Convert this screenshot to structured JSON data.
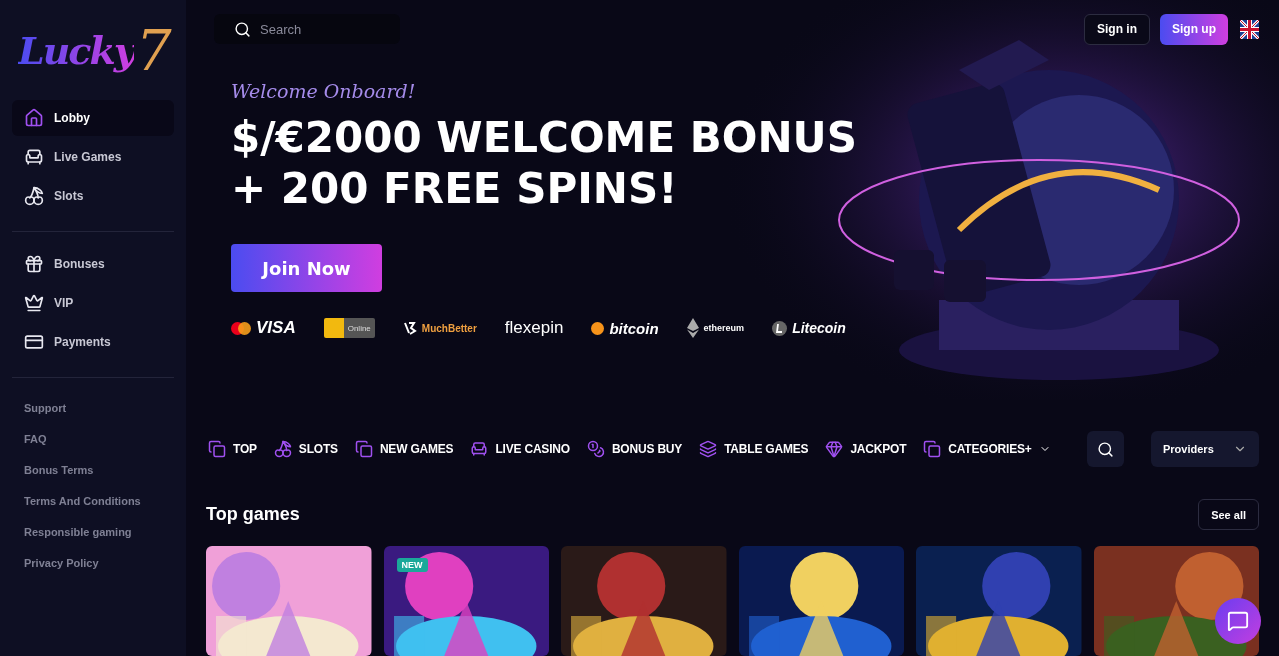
{
  "logo": {
    "word": "Lucky",
    "numeral": "7"
  },
  "sidebar": {
    "items": [
      {
        "label": "Lobby",
        "selected": true
      },
      {
        "label": "Live Games",
        "selected": false
      },
      {
        "label": "Slots",
        "selected": false
      }
    ],
    "secondary": [
      {
        "label": "Bonuses"
      },
      {
        "label": "VIP"
      },
      {
        "label": "Payments"
      }
    ],
    "links": [
      "Support",
      "FAQ",
      "Bonus Terms",
      "Terms And Conditions",
      "Responsible gaming",
      "Privacy Policy"
    ]
  },
  "header": {
    "search": {
      "placeholder": "Search"
    },
    "sign_in": "Sign in",
    "sign_up": "Sign up"
  },
  "hero": {
    "kicker": "Welcome Onboard!",
    "headline": [
      "$/€2000 WELCOME BONUS",
      "+ 200 FREE SPINS!"
    ],
    "cta": "Join Now",
    "payments": [
      {
        "kind": "visa",
        "text": "VISA"
      },
      {
        "kind": "interac",
        "text": "Online"
      },
      {
        "kind": "muchbetter",
        "text": "MuchBetter"
      },
      {
        "kind": "flexepin",
        "text": "flexepin"
      },
      {
        "kind": "bitcoin",
        "text": "bitcoin"
      },
      {
        "kind": "ethereum",
        "text": "ethereum"
      },
      {
        "kind": "litecoin",
        "text": "Litecoin"
      }
    ]
  },
  "categories": [
    {
      "label": "TOP",
      "selected": false
    },
    {
      "label": "SLOTS",
      "selected": false
    },
    {
      "label": "NEW GAMES",
      "selected": false
    },
    {
      "label": "LIVE CASINO",
      "selected": false
    },
    {
      "label": "BONUS BUY",
      "selected": false
    },
    {
      "label": "TABLE GAMES",
      "selected": false
    },
    {
      "label": "JACKPOT",
      "selected": false
    },
    {
      "label": "CATEGORIES+",
      "selected": false
    }
  ],
  "providers": "Providers",
  "top_games": {
    "title": "Top games",
    "see_all": "See all",
    "games": [
      {
        "kind": "picture"
      },
      {
        "kind": "picture",
        "badge": "NEW"
      },
      {
        "kind": "picture"
      },
      {
        "kind": "picture"
      },
      {
        "kind": "picture"
      },
      {
        "kind": "picture"
      }
    ]
  }
}
